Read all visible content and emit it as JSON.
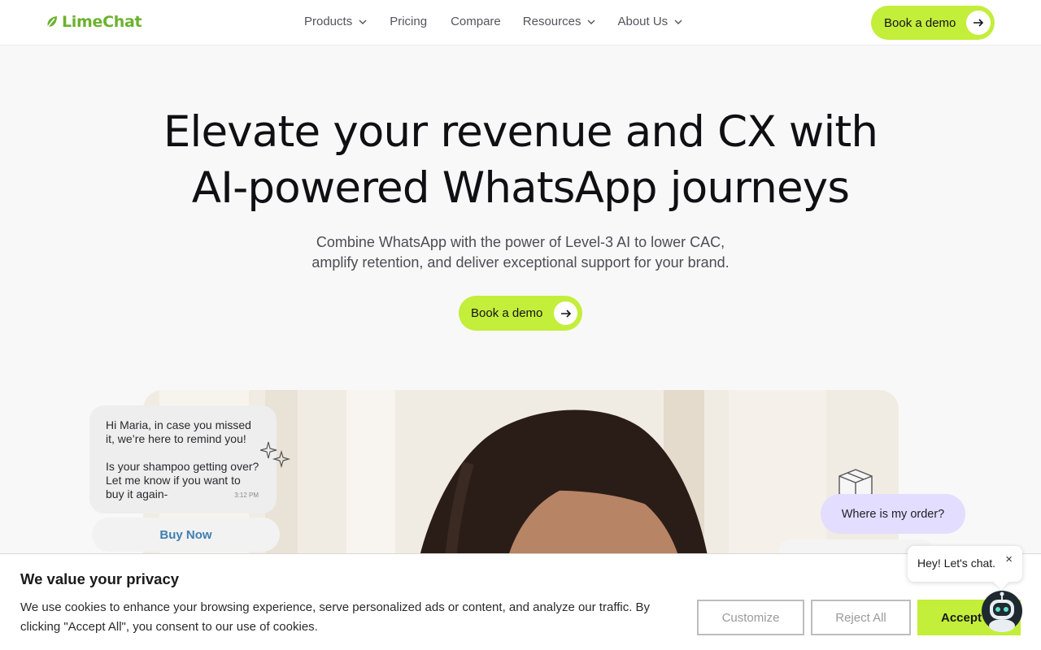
{
  "brand": {
    "name": "LimeChat",
    "accent": "#c3ee3a",
    "logo_color": "#6bb22e"
  },
  "nav": {
    "items": [
      {
        "label": "Products",
        "dropdown": true
      },
      {
        "label": "Pricing",
        "dropdown": false
      },
      {
        "label": "Compare",
        "dropdown": false
      },
      {
        "label": "Resources",
        "dropdown": true
      },
      {
        "label": "About Us",
        "dropdown": true
      }
    ],
    "cta_label": "Book a demo"
  },
  "hero": {
    "title_line1": "Elevate your revenue and CX with",
    "title_line2": "AI-powered WhatsApp journeys",
    "subtitle_line1": "Combine WhatsApp with the power of Level-3 AI to lower CAC,",
    "subtitle_line2": "amplify retention, and deliver exceptional support for your brand.",
    "cta_label": "Book a demo"
  },
  "showcase": {
    "message_para1": "Hi Maria, in case you missed it, we’re here to remind you!",
    "message_para2": "Is your shampoo getting over? Let me know if you want to buy it again-",
    "message_time": "3:12 PM",
    "buy_now_label": "Buy Now",
    "order_question": "Where is my order?",
    "order_bubble_color": "#e3deff"
  },
  "cookie_banner": {
    "title": "We value your privacy",
    "text": "We use cookies to enhance your browsing experience, serve personalized ads or content, and analyze our traffic. By clicking \"Accept All\", you consent to our use of cookies.",
    "customize_label": "Customize",
    "reject_label": "Reject All",
    "accept_label": "Accept All"
  },
  "chat_widget": {
    "greeting": "Hey! Let's chat.",
    "close_glyph": "×"
  }
}
